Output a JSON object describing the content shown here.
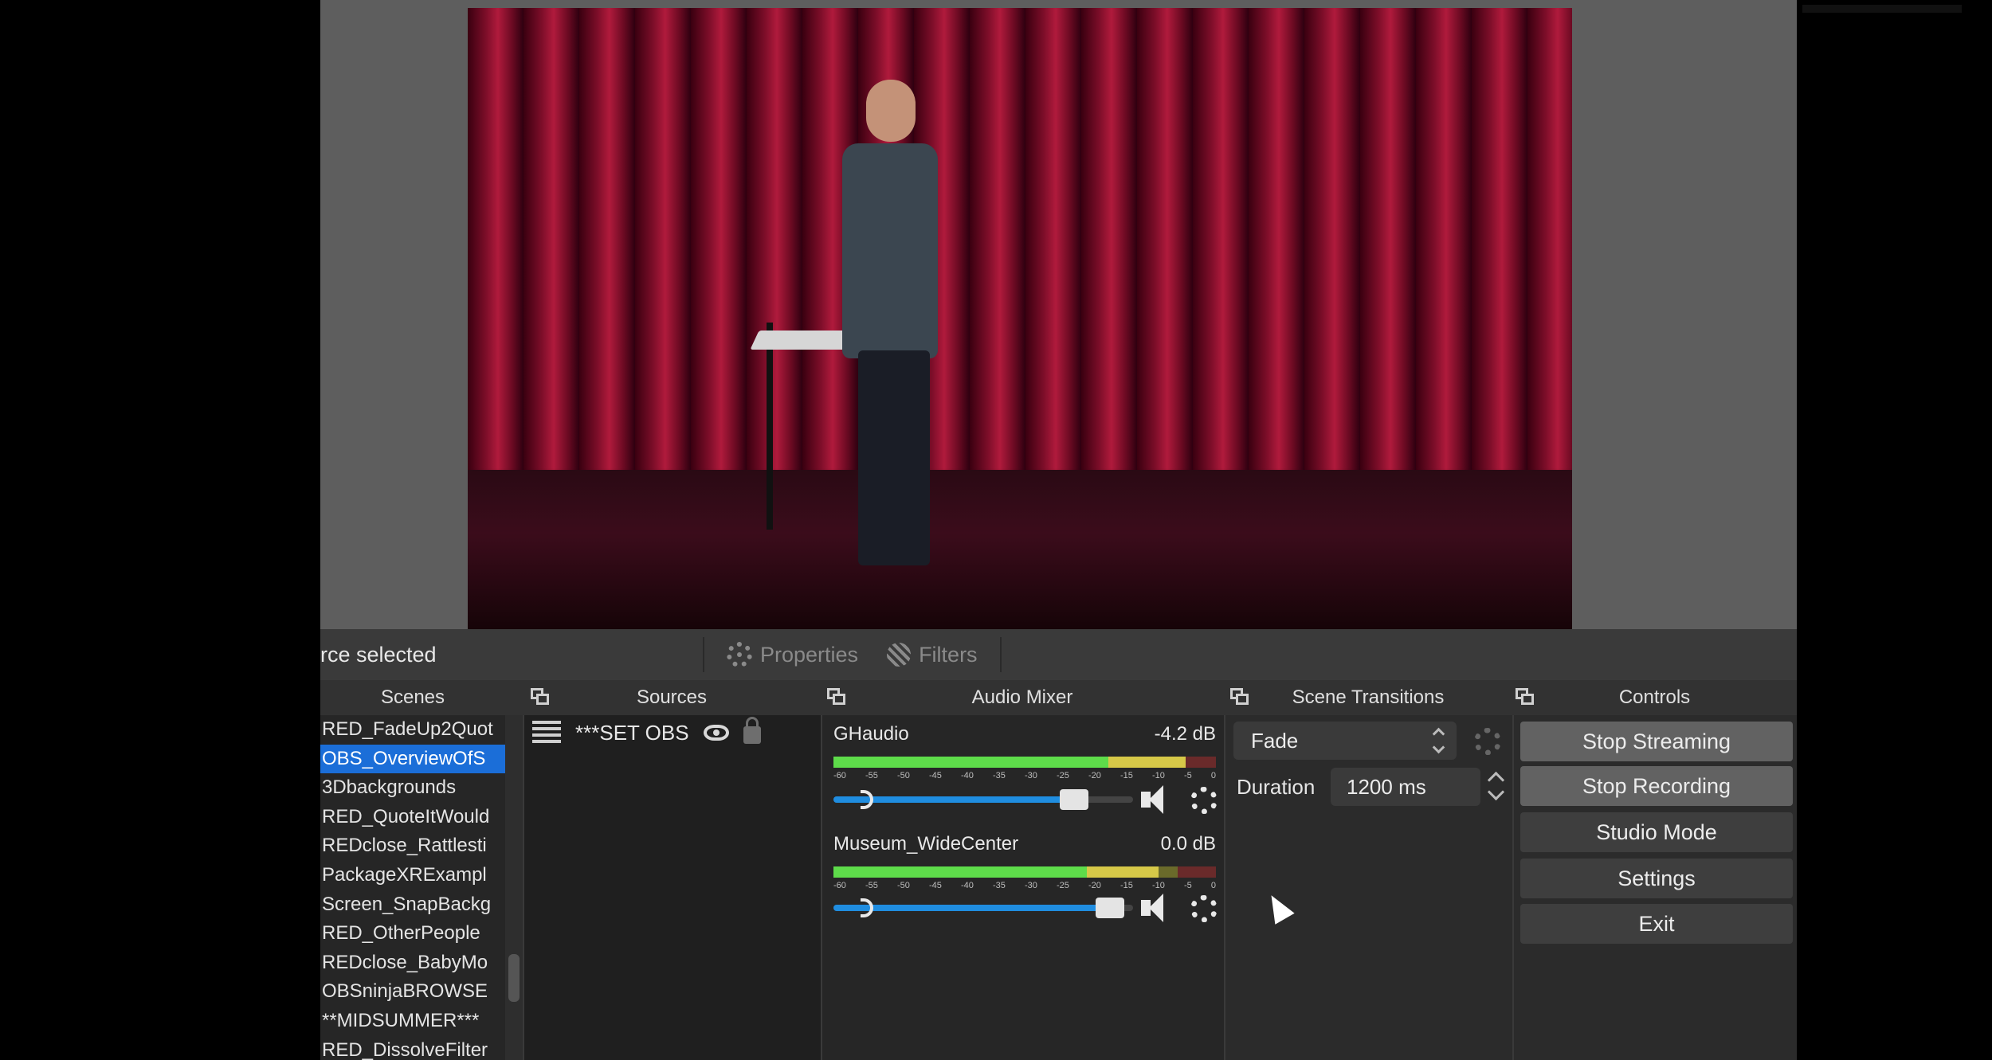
{
  "toolbar": {
    "no_source": "rce selected",
    "properties": "Properties",
    "filters": "Filters"
  },
  "docks": {
    "scenes": "Scenes",
    "sources": "Sources",
    "audio_mixer": "Audio Mixer",
    "scene_transitions": "Scene Transitions",
    "controls": "Controls"
  },
  "scenes": [
    "RED_FadeUp2Quot",
    "OBS_OverviewOfS",
    "3Dbackgrounds",
    "RED_QuoteItWould",
    "REDclose_Rattlesti",
    "PackageXRExampl",
    "Screen_SnapBackg",
    "RED_OtherPeople",
    "REDclose_BabyMo",
    "OBSninjaBROWSE",
    "**MIDSUMMER***",
    "RED_DissolveFilter"
  ],
  "selected_scene_index": 1,
  "sources": [
    {
      "name": "***SET OBS",
      "visible": true,
      "locked": false
    }
  ],
  "mixer": {
    "ticks": [
      "-60",
      "-55",
      "-50",
      "-45",
      "-40",
      "-35",
      "-30",
      "-25",
      "-20",
      "-15",
      "-10",
      "-5",
      "0"
    ],
    "channels": [
      {
        "name": "GHaudio",
        "db": "-4.2 dB",
        "level": 0.92,
        "volume": 0.85
      },
      {
        "name": "Museum_WideCenter",
        "db": "0.0 dB",
        "level": 0.85,
        "volume": 0.97
      }
    ]
  },
  "transitions": {
    "type": "Fade",
    "duration_label": "Duration",
    "duration": "1200 ms"
  },
  "controls": {
    "stop_streaming": "Stop Streaming",
    "stop_recording": "Stop Recording",
    "studio_mode": "Studio Mode",
    "settings": "Settings",
    "exit": "Exit"
  },
  "colors": {
    "selection": "#1b6ed8",
    "meter_green": "#5edc4a",
    "volume_blue": "#1f8de0"
  }
}
